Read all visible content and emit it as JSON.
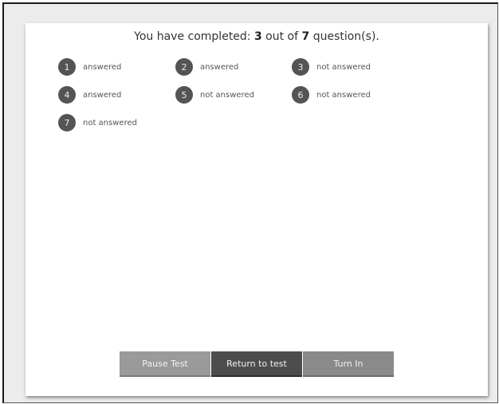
{
  "summary": {
    "prefix": "You have completed: ",
    "completed": "3",
    "middle": " out of ",
    "total": "7",
    "suffix": " question(s)."
  },
  "questions": [
    {
      "number": "1",
      "status": "answered"
    },
    {
      "number": "2",
      "status": "answered"
    },
    {
      "number": "3",
      "status": "not answered"
    },
    {
      "number": "4",
      "status": "answered"
    },
    {
      "number": "5",
      "status": "not answered"
    },
    {
      "number": "6",
      "status": "not answered"
    },
    {
      "number": "7",
      "status": "not answered"
    }
  ],
  "buttons": {
    "pause": "Pause Test",
    "return": "Return to test",
    "turn_in": "Turn In"
  }
}
